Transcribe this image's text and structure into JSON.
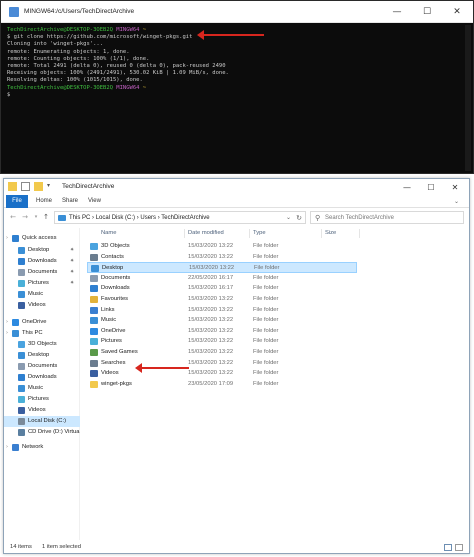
{
  "terminal": {
    "title": "MINGW64:/c/Users/TechDirectArchive",
    "lines": [
      {
        "user": "TechDirectArchive@DESKTOP-3OEB2Q",
        "env": "MINGW64",
        "path": "~"
      },
      {
        "text": "$ git clone https://github.com/microsoft/winget-pkgs.git"
      },
      {
        "text": "Cloning into 'winget-pkgs'..."
      },
      {
        "text": "remote: Enumerating objects: 1, done."
      },
      {
        "text": "remote: Counting objects: 100% (1/1), done."
      },
      {
        "text": "remote: Total 2491 (delta 0), reused 0 (delta 0), pack-reused 2490"
      },
      {
        "text": "Receiving objects: 100% (2491/2491), 530.02 KiB | 1.09 MiB/s, done."
      },
      {
        "text": "Resolving deltas: 100% (1015/1015), done."
      },
      {
        "user": "TechDirectArchive@DESKTOP-3OEB2Q",
        "env": "MINGW64",
        "path": "~"
      },
      {
        "text": "$"
      }
    ]
  },
  "explorer": {
    "title": "TechDirectArchive",
    "ribbon_tabs": [
      "File",
      "Home",
      "Share",
      "View"
    ],
    "breadcrumb": [
      "This PC",
      "Local Disk (C:)",
      "Users",
      "TechDirectArchive"
    ],
    "search_placeholder": "Search TechDirectArchive",
    "columns": [
      "Name",
      "Date modified",
      "Type",
      "Size"
    ],
    "files": [
      {
        "name": "3D Objects",
        "date": "15/03/2020 13:22",
        "type": "File folder",
        "icon": "3d-objects-icon",
        "color": "#4aa3df"
      },
      {
        "name": "Contacts",
        "date": "15/03/2020 13:22",
        "type": "File folder",
        "icon": "contacts-icon",
        "color": "#6b7d8f"
      },
      {
        "name": "Desktop",
        "date": "15/03/2020 13:22",
        "type": "File folder",
        "icon": "desktop-icon",
        "color": "#3a8fd6"
      },
      {
        "name": "Documents",
        "date": "22/05/2020 16:17",
        "type": "File folder",
        "icon": "documents-icon",
        "color": "#8a9bb0"
      },
      {
        "name": "Downloads",
        "date": "15/03/2020 16:17",
        "type": "File folder",
        "icon": "downloads-icon",
        "color": "#2e7fd0"
      },
      {
        "name": "Favourites",
        "date": "15/03/2020 13:22",
        "type": "File folder",
        "icon": "favourites-icon",
        "color": "#e2b23a"
      },
      {
        "name": "Links",
        "date": "15/03/2020 13:22",
        "type": "File folder",
        "icon": "links-icon",
        "color": "#3a7fd0"
      },
      {
        "name": "Music",
        "date": "15/03/2020 13:22",
        "type": "File folder",
        "icon": "music-icon",
        "color": "#3a8fd6"
      },
      {
        "name": "OneDrive",
        "date": "15/03/2020 13:22",
        "type": "File folder",
        "icon": "onedrive-icon",
        "color": "#2d8ae0"
      },
      {
        "name": "Pictures",
        "date": "15/03/2020 13:22",
        "type": "File folder",
        "icon": "pictures-icon",
        "color": "#4ab0d8"
      },
      {
        "name": "Saved Games",
        "date": "15/03/2020 13:22",
        "type": "File folder",
        "icon": "saved-games-icon",
        "color": "#5a9a4a"
      },
      {
        "name": "Searches",
        "date": "15/03/2020 13:22",
        "type": "File folder",
        "icon": "searches-icon",
        "color": "#6b7d8f"
      },
      {
        "name": "Videos",
        "date": "15/03/2020 13:22",
        "type": "File folder",
        "icon": "videos-icon",
        "color": "#3a5fa0"
      },
      {
        "name": "winget-pkgs",
        "date": "23/05/2020 17:09",
        "type": "File folder",
        "icon": "folder-icon",
        "color": "#f2c94c"
      }
    ],
    "selected_row": "Desktop",
    "nav_items": [
      {
        "label": "Quick access",
        "icon": "star-icon",
        "color": "#2e7fd0",
        "level": 0
      },
      {
        "label": "Desktop",
        "icon": "desktop-icon",
        "color": "#3a8fd6",
        "level": 1,
        "pinned": true
      },
      {
        "label": "Downloads",
        "icon": "downloads-icon",
        "color": "#2e7fd0",
        "level": 1,
        "pinned": true
      },
      {
        "label": "Documents",
        "icon": "documents-icon",
        "color": "#8a9bb0",
        "level": 1,
        "pinned": true
      },
      {
        "label": "Pictures",
        "icon": "pictures-icon",
        "color": "#4ab0d8",
        "level": 1,
        "pinned": true
      },
      {
        "label": "Music",
        "icon": "music-icon",
        "color": "#3a8fd6",
        "level": 1
      },
      {
        "label": "Videos",
        "icon": "videos-icon",
        "color": "#3a5fa0",
        "level": 1
      },
      {
        "label": "OneDrive",
        "icon": "onedrive-icon",
        "color": "#2d8ae0",
        "level": 0
      },
      {
        "label": "This PC",
        "icon": "this-pc-icon",
        "color": "#3a8fd6",
        "level": 0
      },
      {
        "label": "3D Objects",
        "icon": "3d-objects-icon",
        "color": "#4aa3df",
        "level": 1
      },
      {
        "label": "Desktop",
        "icon": "desktop-icon",
        "color": "#3a8fd6",
        "level": 1
      },
      {
        "label": "Documents",
        "icon": "documents-icon",
        "color": "#8a9bb0",
        "level": 1
      },
      {
        "label": "Downloads",
        "icon": "downloads-icon",
        "color": "#2e7fd0",
        "level": 1
      },
      {
        "label": "Music",
        "icon": "music-icon",
        "color": "#3a8fd6",
        "level": 1
      },
      {
        "label": "Pictures",
        "icon": "pictures-icon",
        "color": "#4ab0d8",
        "level": 1
      },
      {
        "label": "Videos",
        "icon": "videos-icon",
        "color": "#3a5fa0",
        "level": 1
      },
      {
        "label": "Local Disk (C:)",
        "icon": "drive-icon",
        "color": "#7a8a9a",
        "level": 1,
        "selected": true
      },
      {
        "label": "CD Drive (D:) Virtua",
        "icon": "cd-drive-icon",
        "color": "#5a7fa0",
        "level": 1
      },
      {
        "label": "Network",
        "icon": "network-icon",
        "color": "#3a7fd0",
        "level": 0
      }
    ],
    "status": {
      "count": "14 items",
      "selected": "1 item selected"
    }
  },
  "accent_colors": {
    "arrow": "#d7261e",
    "selection": "#cce8ff",
    "file_tab": "#1a70c8"
  }
}
